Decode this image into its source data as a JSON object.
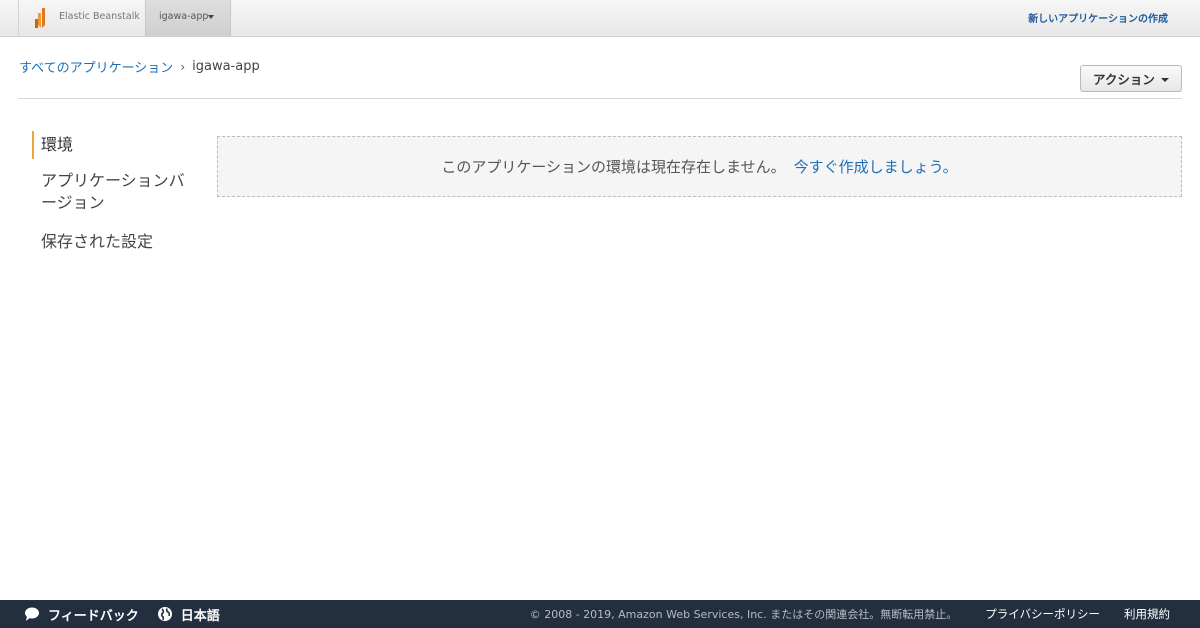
{
  "topbar": {
    "service_name": "Elastic Beanstalk",
    "app_selector_label": "igawa-app",
    "create_app_link": "新しいアプリケーションの作成"
  },
  "breadcrumb": {
    "root": "すべてのアプリケーション",
    "separator": "›",
    "current": "igawa-app"
  },
  "actions_button": {
    "label": "アクション"
  },
  "sidenav": {
    "items": [
      {
        "label": "環境",
        "active": true
      },
      {
        "label": "アプリケーションバージョン",
        "active": false
      },
      {
        "label": "保存された設定",
        "active": false
      }
    ]
  },
  "empty_state": {
    "message": "このアプリケーションの環境は現在存在しません。",
    "link": "今すぐ作成しましょう。"
  },
  "footer": {
    "feedback": "フィードバック",
    "language": "日本語",
    "copyright": "© 2008 - 2019, Amazon Web Services, Inc. またはその関連会社。無断転用禁止。",
    "privacy": "プライバシーポリシー",
    "terms": "利用規約"
  },
  "colors": {
    "accent_orange": "#f0a33a",
    "link_blue": "#1f6fb5",
    "footer_bg": "#232f3e"
  },
  "icons": {
    "brand": "elastic-beanstalk-icon",
    "feedback": "speech-bubble-icon",
    "language": "globe-icon"
  }
}
